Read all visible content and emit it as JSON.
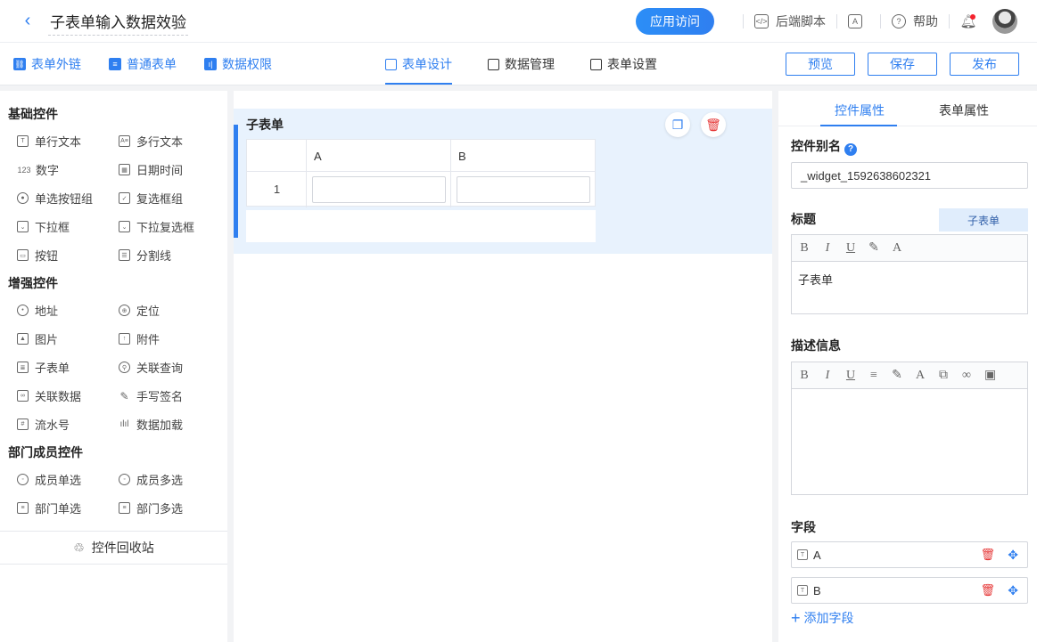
{
  "header": {
    "title": "子表单输入数据效验",
    "app_visit": "应用访问",
    "backend_script": "后端脚本",
    "help": "帮助"
  },
  "toolbar": {
    "left_items": [
      "表单外链",
      "普通表单",
      "数据权限"
    ],
    "tabs": [
      "表单设计",
      "数据管理",
      "表单设置"
    ],
    "active_tab": "表单设计",
    "preview": "预览",
    "save": "保存",
    "publish": "发布"
  },
  "left_panel": {
    "basic_title": "基础控件",
    "basic": [
      "单行文本",
      "多行文本",
      "数字",
      "日期时间",
      "单选按钮组",
      "复选框组",
      "下拉框",
      "下拉复选框",
      "按钮",
      "分割线"
    ],
    "enhanced_title": "增强控件",
    "enhanced": [
      "地址",
      "定位",
      "图片",
      "附件",
      "子表单",
      "关联查询",
      "关联数据",
      "手写签名",
      "流水号",
      "数据加载"
    ],
    "dept_title": "部门成员控件",
    "dept": [
      "成员单选",
      "成员多选",
      "部门单选",
      "部门多选"
    ],
    "recycle": "控件回收站"
  },
  "canvas": {
    "subform_title": "子表单",
    "columns": [
      "A",
      "B"
    ],
    "row_number": "1"
  },
  "right_panel": {
    "tabs": [
      "控件属性",
      "表单属性"
    ],
    "active_tab": "控件属性",
    "alias_label": "控件别名",
    "alias_value": "_widget_1592638602321",
    "title_label": "标题",
    "title_badge": "子表单",
    "title_value": "子表单",
    "desc_label": "描述信息",
    "fields_label": "字段",
    "fields": [
      "A",
      "B"
    ],
    "add_field": "添加字段"
  },
  "colors": {
    "accent": "#2f7ff0",
    "danger": "#e53535",
    "selected_bg": "#e8f2fd"
  }
}
